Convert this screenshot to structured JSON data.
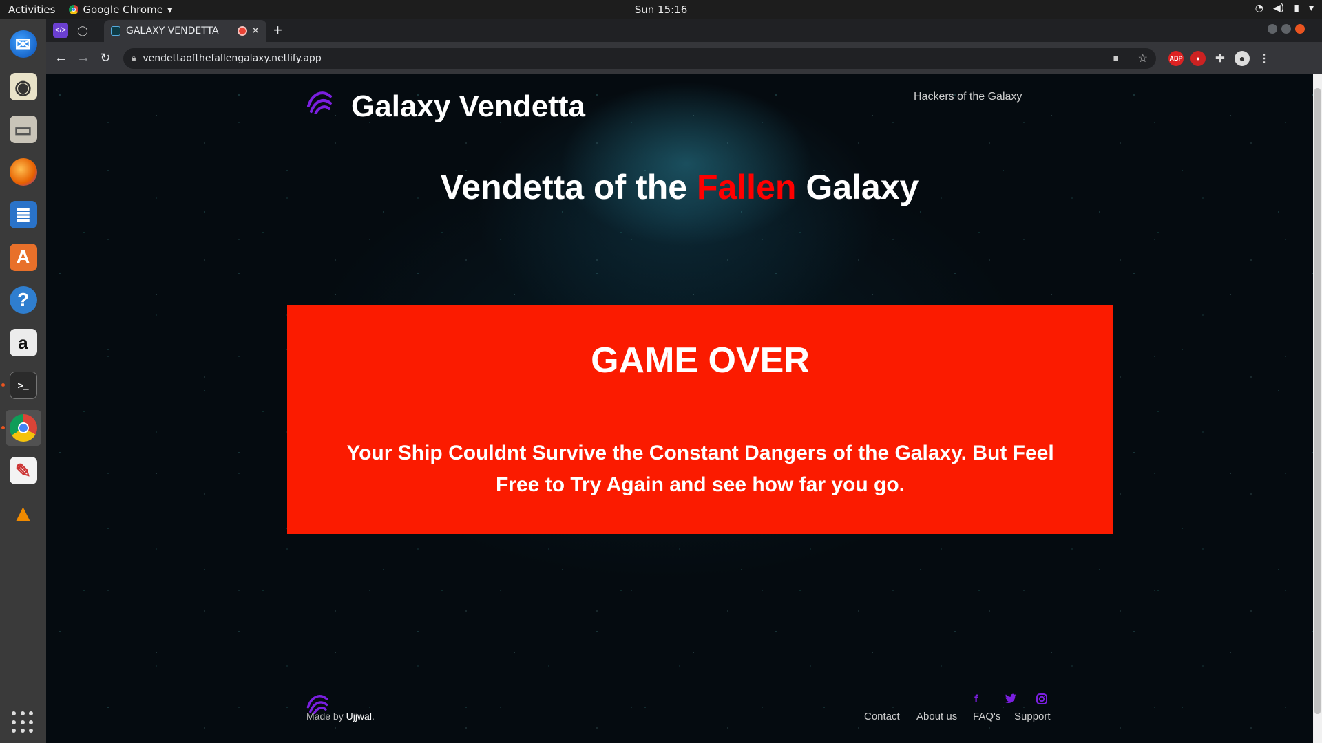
{
  "os": {
    "activities_label": "Activities",
    "app_name": "Google Chrome",
    "clock": "Sun 15:16"
  },
  "browser": {
    "tab_title": "GALAXY VENDETTA",
    "new_tab_symbol": "+",
    "url": "vendettaofthefallengalaxy.netlify.app",
    "ext_abp": "ABP"
  },
  "site": {
    "title": "Galaxy Vendetta",
    "nav_link": "Hackers of the Galaxy",
    "hero_part1": "Vendetta of the ",
    "hero_accent": "Fallen",
    "hero_part2": " Galaxy",
    "accent_color": "#ff0000",
    "game_over_heading": "GAME OVER",
    "game_over_message": "Your Ship Couldnt Survive the Constant Dangers of the Galaxy. But Feel Free to Try Again and see how far you go.",
    "panel_color": "#fb1b00",
    "brand_color": "#7b1fe0"
  },
  "footer": {
    "made_by_prefix": "Made by ",
    "author": "Ujjwal",
    "made_by_suffix": ".",
    "social": [
      "f",
      "t",
      "ig"
    ],
    "links": [
      "Contact",
      "About us",
      "FAQ's",
      "Support"
    ]
  }
}
